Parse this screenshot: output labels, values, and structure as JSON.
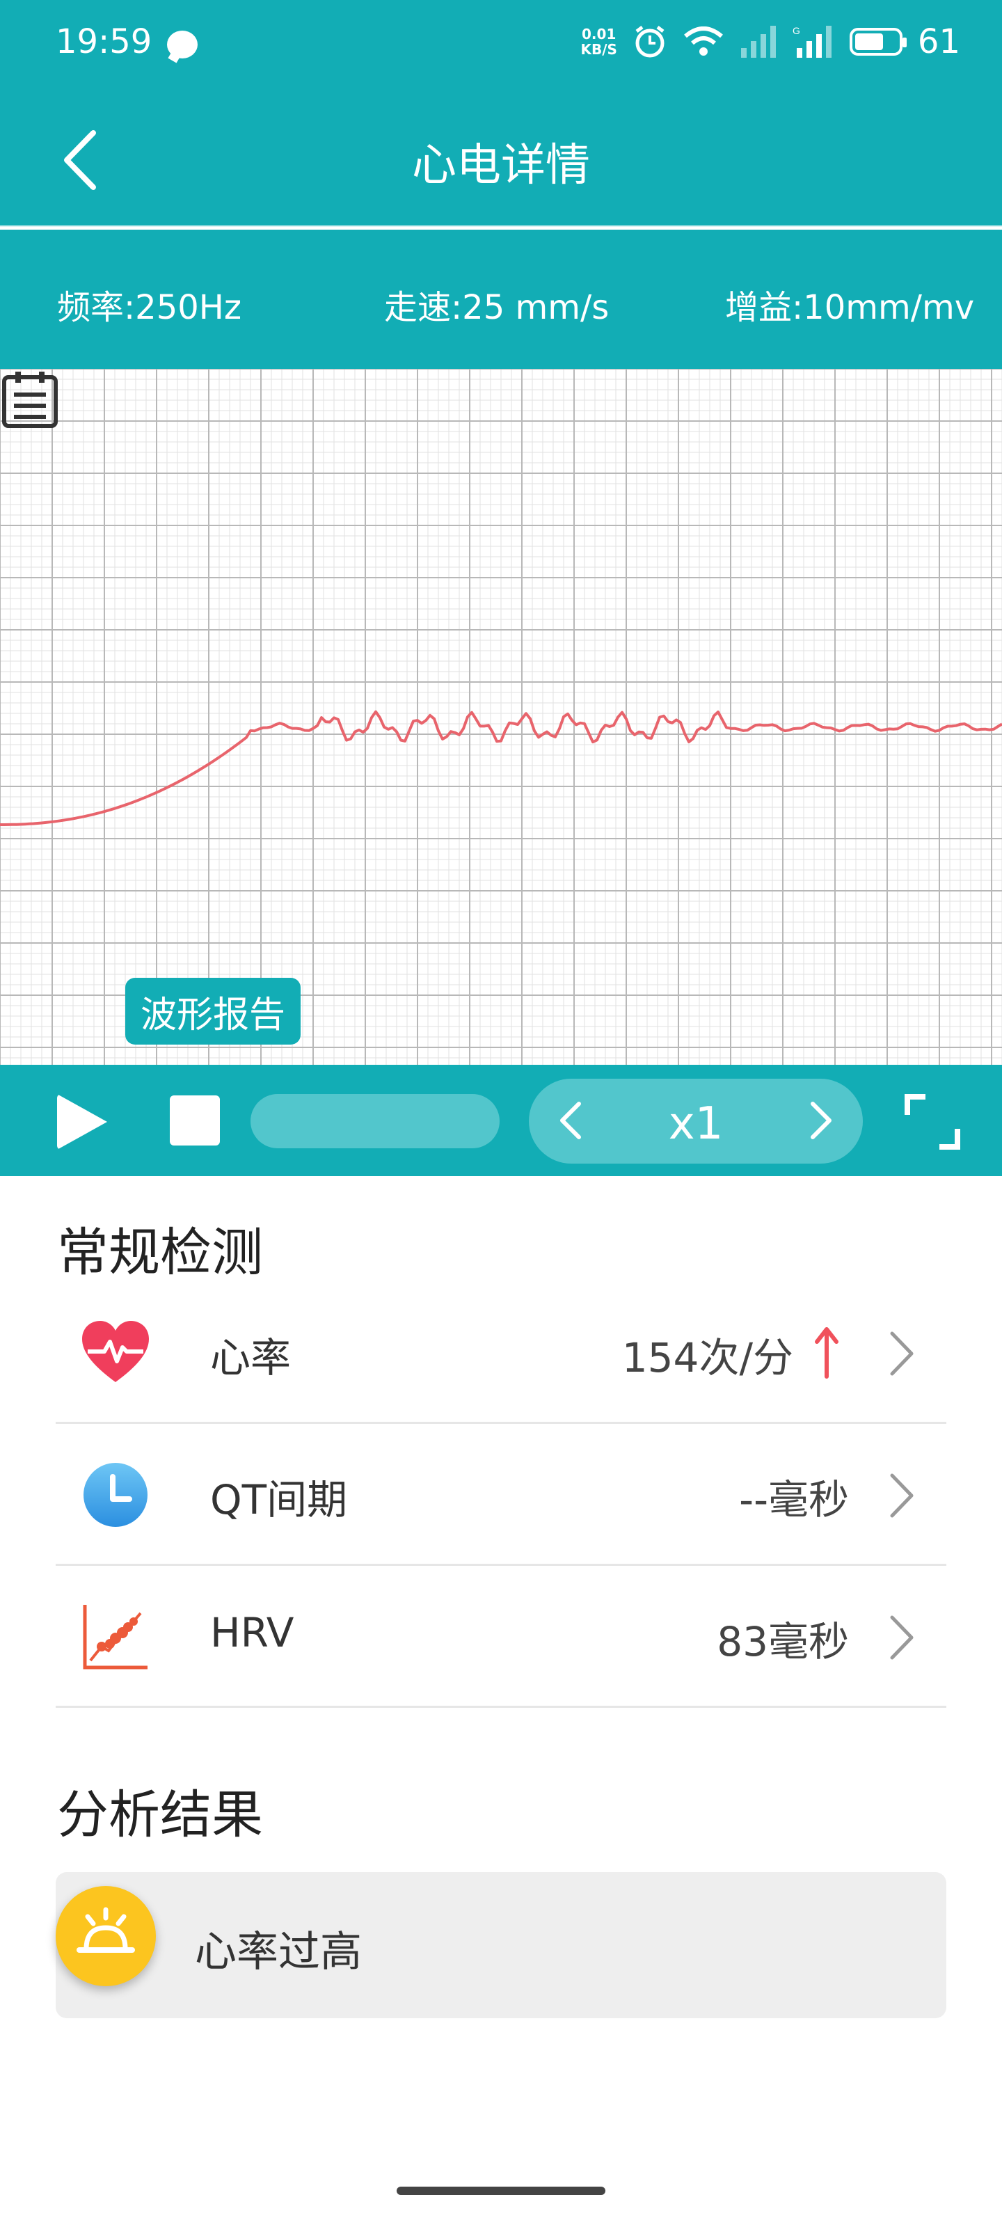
{
  "status_bar": {
    "time": "19:59",
    "net_speed_value": "0.01",
    "net_speed_unit": "KB/S",
    "battery_level": "61",
    "signal_label": "G"
  },
  "header": {
    "title": "心电详情",
    "back_icon": "chevron-left-icon"
  },
  "params": {
    "sample_rate": "频率:250Hz",
    "paper_speed": "走速:25 mm/s",
    "gain": "增益:10mm/mv"
  },
  "ecg": {
    "report_button_label": "波形报告",
    "line_color": "#e8646c",
    "grid_color": "#b8b8b8"
  },
  "controls": {
    "playback_speed": "x1"
  },
  "routine": {
    "title": "常规检测",
    "items": [
      {
        "label": "心率",
        "value": "154次/分",
        "icon": "heart-rate-icon",
        "alert": "up-arrow-icon"
      },
      {
        "label": "QT间期",
        "value": "--毫秒",
        "icon": "clock-icon"
      },
      {
        "label": "HRV",
        "value": "83毫秒",
        "icon": "hrv-scatter-icon"
      }
    ]
  },
  "analysis": {
    "title": "分析结果",
    "result": "心率过高",
    "icon": "alarm-light-icon"
  },
  "colors": {
    "primary": "#12adb5",
    "heart": "#f03e5c",
    "alert": "#f0515b",
    "warning": "#fcc51f"
  }
}
